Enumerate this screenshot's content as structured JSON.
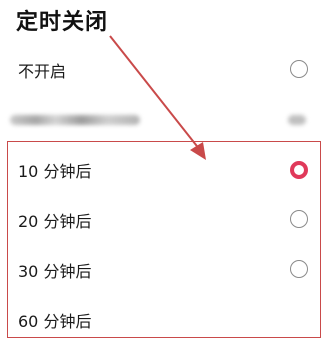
{
  "header": {
    "title": "定时关闭"
  },
  "options": [
    {
      "label": "不开启",
      "selected": false
    },
    {
      "label": "",
      "selected": false,
      "obscured": true
    },
    {
      "label": "10 分钟后",
      "selected": true
    },
    {
      "label": "20 分钟后",
      "selected": false
    },
    {
      "label": "30 分钟后",
      "selected": false
    },
    {
      "label": "60 分钟后",
      "selected": false
    }
  ],
  "colors": {
    "accent": "#e0395a",
    "annotation": "#c94a4a"
  }
}
